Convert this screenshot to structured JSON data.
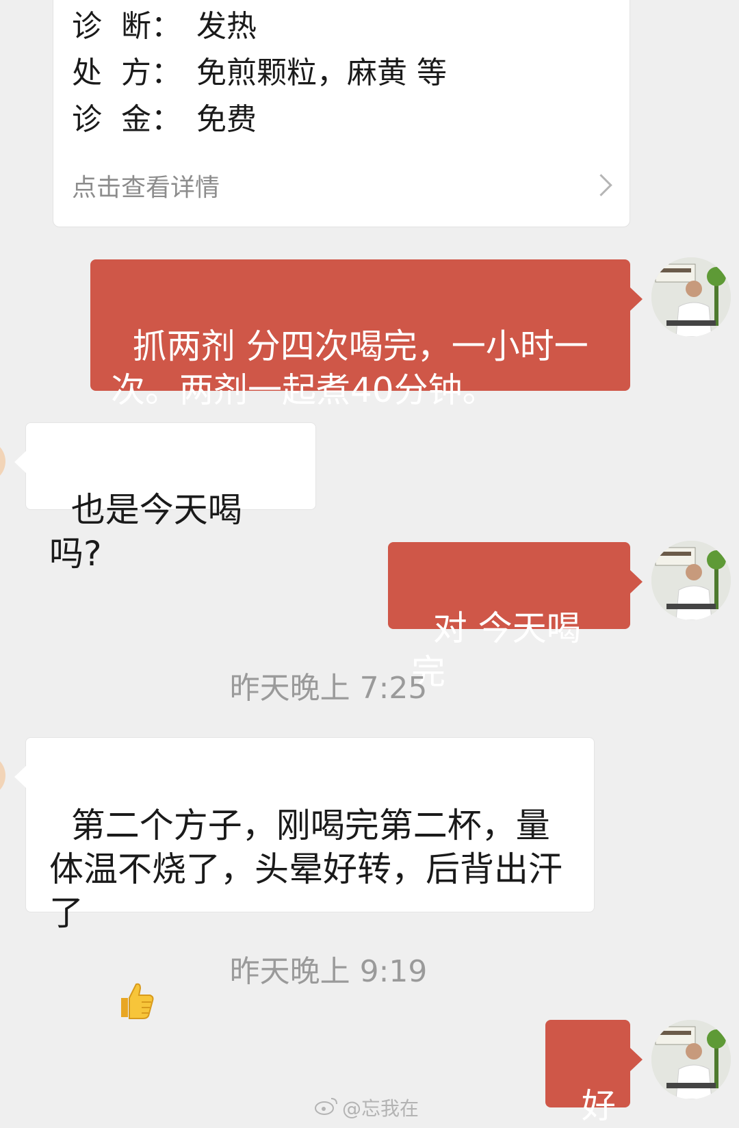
{
  "prescription_card": {
    "rows": [
      {
        "label": "诊  断：",
        "value": "发热"
      },
      {
        "label": "处  方：",
        "value": "免煎颗粒，麻黄 等"
      },
      {
        "label": "诊  金：",
        "value": "免费"
      }
    ],
    "detail_link": "点击查看详情"
  },
  "messages": [
    {
      "side": "out",
      "text": "抓两剂 分四次喝完，一小时一次。两剂一起煮40分钟。"
    },
    {
      "side": "in",
      "text": "也是今天喝吗?"
    },
    {
      "side": "out",
      "text": "对 今天喝完"
    },
    {
      "type": "time",
      "text": "昨天晚上 7:25"
    },
    {
      "side": "in",
      "text": "第二个方子，刚喝完第二杯，量体温不烧了，头晕好转，后背出汗了",
      "emoji": "thumbs-up"
    },
    {
      "type": "time",
      "text": "昨天晚上 9:19"
    },
    {
      "side": "out",
      "text": "好"
    }
  ],
  "watermark": "@忘我在",
  "colors": {
    "outgoing_bubble": "#cf5748",
    "incoming_bubble": "#ffffff",
    "background": "#efefef"
  }
}
